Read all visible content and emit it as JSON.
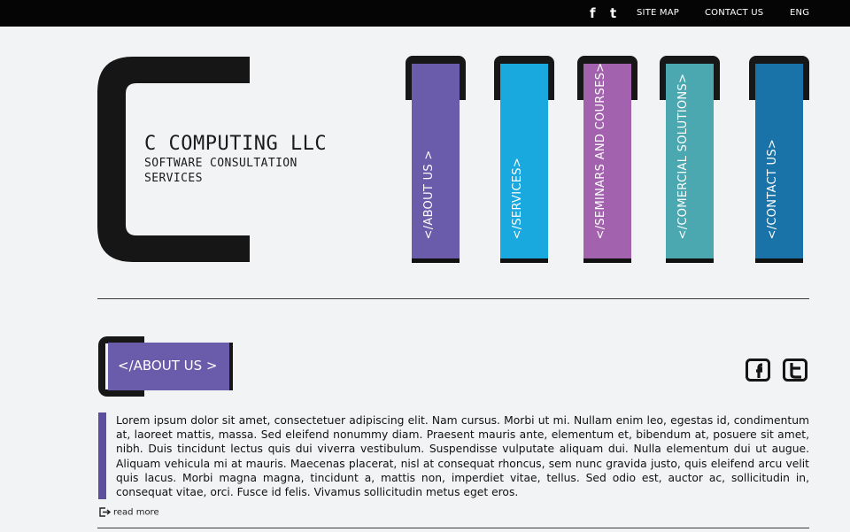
{
  "topbar": {
    "social": [
      "f",
      "t"
    ],
    "links": [
      "SITE MAP",
      "CONTACT US",
      "ENG"
    ]
  },
  "logo": {
    "title": "C COMPUTING LLC",
    "subtitle_line1": "SOFTWARE CONSULTATION",
    "subtitle_line2": "SERVICES"
  },
  "nav": {
    "tabs": [
      {
        "label": "</ABOUT US >",
        "color": "#6a5bab"
      },
      {
        "label": "</SERVICES>",
        "color": "#19a9df"
      },
      {
        "label": "</SEMINARS AND COURSES>",
        "color": "#a362ad"
      },
      {
        "label": "</COMERCIAL SOLUTIONS>",
        "color": "#4ba8b0"
      },
      {
        "label": "</CONTACT US>",
        "color": "#1a73a8"
      }
    ]
  },
  "section": {
    "heading": "</ABOUT US >",
    "paragraph": "Lorem ipsum dolor sit amet, consectetuer adipiscing elit. Nam cursus. Morbi ut mi. Nullam enim leo, egestas id, condimentum at, laoreet mattis, massa. Sed eleifend nonummy diam. Praesent mauris ante, elementum et, bibendum at, posuere sit amet, nibh. Duis tincidunt lectus quis dui viverra vestibulum. Suspendisse vulputate aliquam dui. Nulla elementum dui ut augue. Aliquam vehicula mi at mauris. Maecenas placerat, nisl at consequat rhoncus, sem nunc gravida justo, quis eleifend arcu velit quis lacus. Morbi magna magna, tincidunt a, mattis non, imperdiet vitae, tellus. Sed odio est, auctor ac, sollicitudin in, consequat vitae, orci. Fusce id felis. Vivamus sollicitudin metus eget eros.",
    "read_more": "read more",
    "social_icons": [
      "facebook-icon",
      "twitter-icon"
    ]
  }
}
